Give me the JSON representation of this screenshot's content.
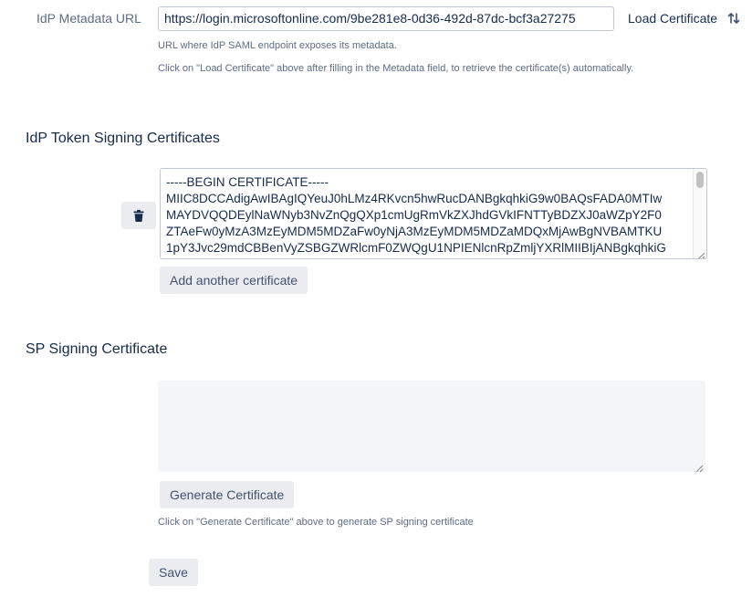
{
  "idp_metadata": {
    "label": "IdP Metadata URL",
    "value": "https://login.microsoftonline.com/9be281e8-0d36-492d-87dc-bcf3a27275",
    "load_certificate_label": "Load Certificate",
    "help_1": "URL where IdP SAML endpoint exposes its metadata.",
    "help_2": "Click on \"Load Certificate\" above after filling in the Metadata field, to retrieve the certificate(s) automatically."
  },
  "idp_certificates": {
    "heading": "IdP Token Signing Certificates",
    "certificate_text": "-----BEGIN CERTIFICATE-----\nMIIC8DCCAdigAwIBAgIQYeuJ0hLMz4RKvcn5hwRucDANBgkqhkiG9w0BAQsFADA0MTIw\nMAYDVQQDEylNaWNyb3NvZnQgQXp1cmUgRmVkZXJhdGVkIFNTTyBDZXJ0aWZpY2F0\nZTAeFw0yMzA3MzEyMDM5MDZaFw0yNjA3MzEyMDM5MDZaMDQxMjAwBgNVBAMTKU\n1pY3Jvc29mdCBBenVyZSBGZWRlcmF0ZWQgU1NPIENlcnRpZmljYXRlMIIBIjANBgkqhkiG",
    "add_another_label": "Add another certificate"
  },
  "sp_certificate": {
    "heading": "SP Signing Certificate",
    "value": "",
    "generate_label": "Generate Certificate",
    "help": "Click on \"Generate Certificate\" above to generate SP signing certificate"
  },
  "save_label": "Save",
  "icons": {
    "load": "swap-vertical-icon",
    "delete": "trash-icon"
  },
  "colors": {
    "label": "#5e6c84",
    "text": "#172b4d",
    "button_bg": "#ebecf0",
    "border": "#c1c7d0"
  }
}
